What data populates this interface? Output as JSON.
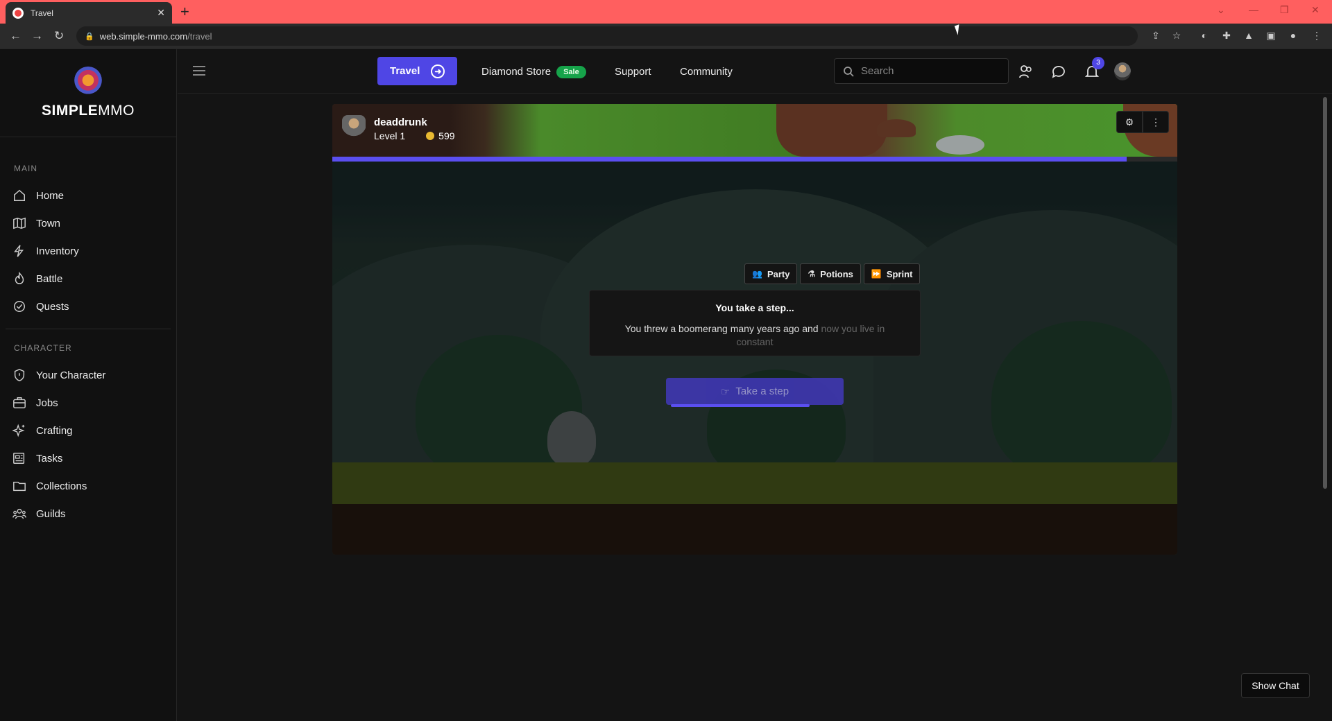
{
  "browser": {
    "tab_title": "Travel",
    "url_host": "web.simple-mmo.com",
    "url_path": "/travel"
  },
  "brand": {
    "bold": "SIMPLE",
    "thin": "MMO"
  },
  "sidebar": {
    "main_title": "MAIN",
    "main_items": [
      {
        "label": "Home",
        "icon": "home-icon"
      },
      {
        "label": "Town",
        "icon": "map-icon"
      },
      {
        "label": "Inventory",
        "icon": "bolt-icon"
      },
      {
        "label": "Battle",
        "icon": "flame-icon"
      },
      {
        "label": "Quests",
        "icon": "check-circle-icon"
      }
    ],
    "character_title": "CHARACTER",
    "character_items": [
      {
        "label": "Your Character",
        "icon": "shield-icon"
      },
      {
        "label": "Jobs",
        "icon": "briefcase-icon"
      },
      {
        "label": "Crafting",
        "icon": "sparkles-icon"
      },
      {
        "label": "Tasks",
        "icon": "newspaper-icon"
      },
      {
        "label": "Collections",
        "icon": "folder-icon"
      },
      {
        "label": "Guilds",
        "icon": "users-icon"
      }
    ]
  },
  "topnav": {
    "travel_label": "Travel",
    "diamond_store_label": "Diamond Store",
    "sale_badge": "Sale",
    "support_label": "Support",
    "community_label": "Community",
    "search_placeholder": "Search",
    "notification_count": "3"
  },
  "player": {
    "name": "deaddrunk",
    "level_text": "Level 1",
    "gold": "599",
    "progress_fraction": 0.94
  },
  "actions": {
    "party_label": "Party",
    "potions_label": "Potions",
    "sprint_label": "Sprint"
  },
  "step": {
    "title": "You take a step...",
    "text_main": "You threw a boomerang many years ago and ",
    "text_fade": "now you live in constant",
    "button_label": "Take a step"
  },
  "chat": {
    "show_label": "Show Chat"
  },
  "colors": {
    "accent": "#4f46e5",
    "sale": "#16a34a",
    "chrome_tabstrip": "#ff5f5f"
  }
}
